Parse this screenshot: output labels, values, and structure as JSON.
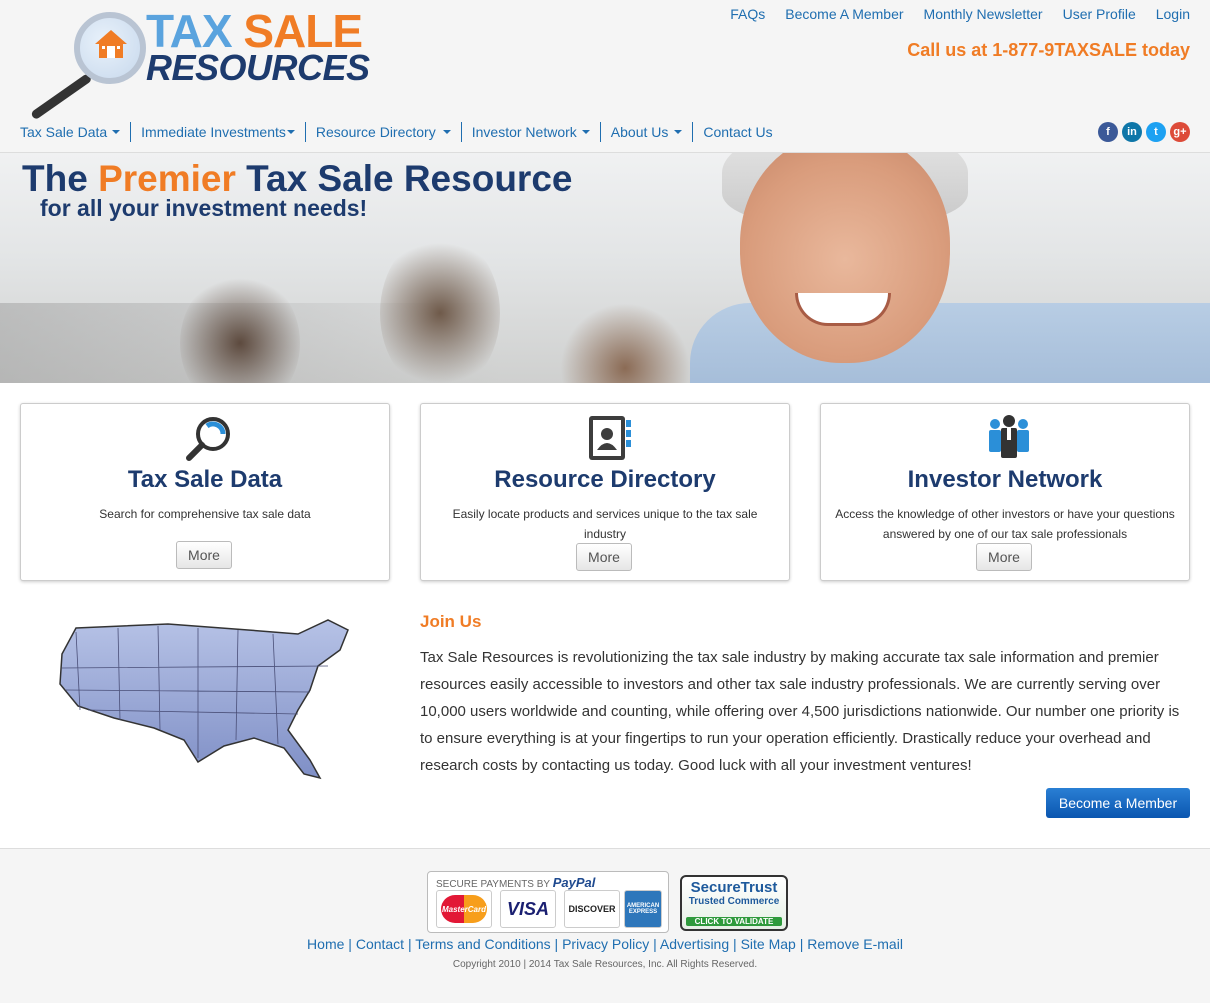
{
  "brand": {
    "logo_word1_a": "TAX",
    "logo_word1_b": "SALE",
    "logo_word2": "RESOURCES",
    "colors": {
      "navy": "#1d3b6e",
      "orange": "#f07c25",
      "link": "#1f6eb0"
    }
  },
  "toplinks": [
    "FAQs",
    "Become A Member",
    "Monthly Newsletter",
    "User Profile",
    "Login"
  ],
  "callus": "Call us at 1-877-9TAXSALE today",
  "nav": [
    {
      "label": "Tax Sale Data",
      "dropdown": true
    },
    {
      "label": "Immediate Investments",
      "dropdown": true
    },
    {
      "label": "Resource Directory",
      "dropdown": true
    },
    {
      "label": "Investor Network",
      "dropdown": true
    },
    {
      "label": "About Us",
      "dropdown": true
    },
    {
      "label": "Contact Us",
      "dropdown": false
    }
  ],
  "social": [
    {
      "icon": "facebook-icon",
      "glyph": "f",
      "color": "#3b5998"
    },
    {
      "icon": "linkedin-icon",
      "glyph": "in",
      "color": "#0e76a8"
    },
    {
      "icon": "twitter-icon",
      "glyph": "t",
      "color": "#1da1f2"
    },
    {
      "icon": "googleplus-icon",
      "glyph": "g+",
      "color": "#dd4b39"
    }
  ],
  "hero": {
    "title_a": "The ",
    "title_accent": "Premier",
    "title_b": " Tax Sale Resource",
    "subtitle": "for all your investment needs!"
  },
  "features": [
    {
      "title": "Tax Sale Data",
      "text": "Search for comprehensive tax sale data",
      "button": "More",
      "icon": "magnifier-icon"
    },
    {
      "title": "Resource Directory",
      "text": "Easily locate products and services unique to the tax sale industry",
      "button": "More",
      "icon": "address-book-icon"
    },
    {
      "title": "Investor Network",
      "text": "Access the knowledge of other investors or have your questions answered by one of our tax sale professionals",
      "button": "More",
      "icon": "people-icon"
    }
  ],
  "join": {
    "title": "Join Us",
    "text": "Tax Sale Resources is revolutionizing the tax sale industry by making accurate tax sale information and premier resources easily accessible to investors and other tax sale industry professionals. We are currently serving over 10,000 users worldwide and counting, while offering over 4,500 jurisdictions nationwide. Our number one priority is to ensure everything is at your fingertips to run your operation efficiently. Drastically reduce your overhead and research costs by contacting us today. Good luck with all your investment ventures!",
    "button": "Become a Member"
  },
  "footer": {
    "paypal_caption": "SECURE PAYMENTS BY",
    "paypal_brand": "PayPal",
    "cards": [
      "MasterCard",
      "VISA",
      "DISCOVER",
      "AMERICAN EXPRESS"
    ],
    "securetrust": [
      "SecureTrust",
      "Trusted Commerce",
      "CLICK TO VALIDATE"
    ],
    "links": [
      "Home",
      "Contact",
      "Terms and Conditions",
      "Privacy Policy",
      "Advertising",
      "Site Map",
      "Remove E-mail"
    ],
    "copyright": "Copyright 2010 | 2014 Tax Sale Resources, Inc. All Rights Reserved."
  }
}
